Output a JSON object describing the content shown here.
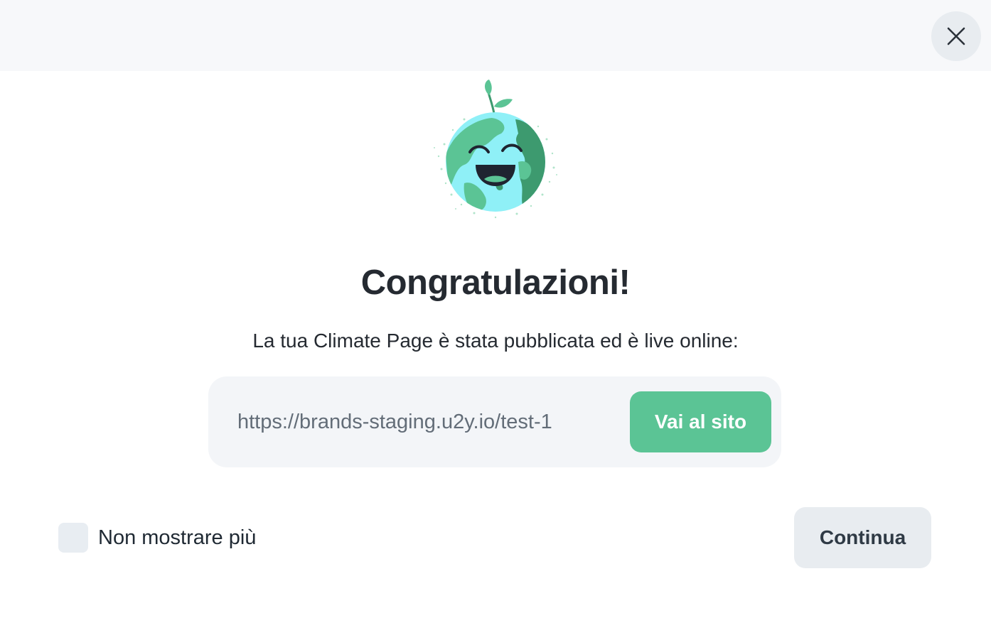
{
  "header": {
    "close_icon": "close-icon"
  },
  "hero": {
    "illustration": "smiling-earth-with-sprout",
    "colors": {
      "earth_water": "#8ff0f7",
      "earth_land": "#5bc495",
      "earth_land_dark": "#3d9a6f",
      "face": "#1f2430",
      "sprout": "#5bc495"
    }
  },
  "content": {
    "title": "Congratulazioni!",
    "subtitle": "La tua Climate Page è stata pubblicata ed è live online:",
    "url": "https://brands-staging.u2y.io/test-1",
    "visit_button_label": "Vai al sito"
  },
  "footer": {
    "dont_show_label": "Non mostrare più",
    "dont_show_checked": false,
    "continue_label": "Continua"
  },
  "colors": {
    "accent": "#5bc495",
    "text_primary": "#252a31",
    "text_muted": "#636d78",
    "surface_light": "#f3f5f8",
    "button_secondary": "#e8ecf0"
  }
}
